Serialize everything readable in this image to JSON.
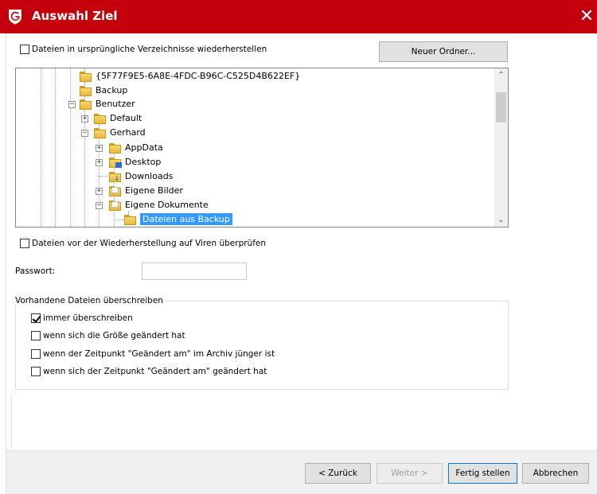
{
  "window": {
    "title": "Auswahl Ziel",
    "close_glyph": "✕",
    "title_bar_color": "#c4000c"
  },
  "restore_original_dirs": {
    "label": "Dateien in ursprüngliche Verzeichnisse wiederherstellen",
    "checked": false
  },
  "new_folder_button": "Neuer Ordner...",
  "tree": {
    "items": [
      {
        "label": "{5F77F9E5-6A8E-4FDC-B96C-C525D4B622EF}",
        "icon": "folder-icon"
      },
      {
        "label": "Backup",
        "icon": "folder-icon"
      },
      {
        "label": "Benutzer",
        "icon": "folder-icon",
        "expanded": true
      },
      {
        "label": "Default",
        "icon": "folder-icon",
        "expanded": false
      },
      {
        "label": "Gerhard",
        "icon": "folder-icon",
        "expanded": true
      },
      {
        "label": "AppData",
        "icon": "folder-icon",
        "expanded": false
      },
      {
        "label": "Desktop",
        "icon": "desktop-folder-icon",
        "expanded": false
      },
      {
        "label": "Downloads",
        "icon": "downloads-folder-icon"
      },
      {
        "label": "Eigene Bilder",
        "icon": "pictures-folder-icon",
        "expanded": false
      },
      {
        "label": "Eigene Dokumente",
        "icon": "documents-folder-icon",
        "expanded": true
      },
      {
        "label": "Dateien aus Backup",
        "icon": "folder-icon",
        "selected": true
      }
    ],
    "selection_color": "#3399ff"
  },
  "virus_check": {
    "label": "Dateien vor der Wiederherstellung auf Viren überprüfen",
    "checked": false
  },
  "password": {
    "label": "Passwort:",
    "value": ""
  },
  "overwrite_group": {
    "legend": "Vorhandene Dateien überschreiben",
    "options": [
      {
        "label": "immer überschreiben",
        "checked": true
      },
      {
        "label": "wenn sich die Größe geändert hat",
        "checked": false
      },
      {
        "label": "wenn der Zeitpunkt \"Geändert am\" im Archiv jünger ist",
        "checked": false
      },
      {
        "label": "wenn sich der Zeitpunkt \"Geändert am\" geändert hat",
        "checked": false
      }
    ]
  },
  "footer": {
    "back_button": "< Zurück",
    "next_button": "Weiter >",
    "finish_button": "Fertig stellen",
    "cancel_button": "Abbrechen"
  }
}
